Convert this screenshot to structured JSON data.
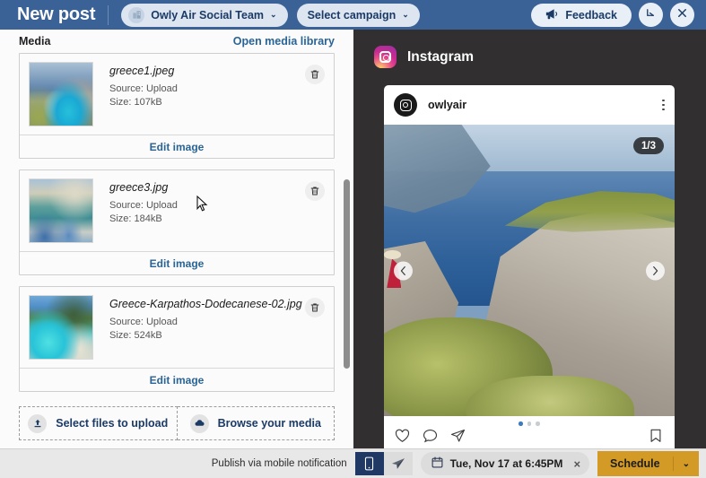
{
  "header": {
    "title": "New post",
    "team": {
      "label": "Owly Air Social Team",
      "icon": "building-icon",
      "caret": "⌄"
    },
    "campaign": {
      "label": "Select campaign",
      "caret": "⌄"
    },
    "feedback": {
      "label": "Feedback",
      "icon": "megaphone-icon"
    },
    "minimize_icon": "arrow-down-right-icon",
    "close_icon": "close-icon"
  },
  "composer": {
    "media_label": "Media",
    "open_library_label": "Open media library",
    "edit_label": "Edit image",
    "source_prefix": "Source:",
    "size_prefix": "Size:",
    "items": [
      {
        "filename": "greece1.jpeg",
        "source": "Source: Upload",
        "size": "Size: 107kB",
        "edit": "Edit image"
      },
      {
        "filename": "greece3.jpg",
        "source": "Source: Upload",
        "size": "Size: 184kB",
        "edit": "Edit image"
      },
      {
        "filename": "Greece-Karpathos-Dodecanese-02.jpg",
        "source": "Source: Upload",
        "size": "Size: 524kB",
        "edit": "Edit image"
      }
    ],
    "upload_buttons": [
      {
        "label": "Select files to upload",
        "icon": "upload-icon"
      },
      {
        "label": "Browse your media",
        "icon": "cloud-icon"
      }
    ]
  },
  "preview": {
    "network": "Instagram",
    "account": "owlyair",
    "counter": "1/3",
    "prev_icon": "chevron-left-icon",
    "next_icon": "chevron-right-icon",
    "menu_icon": "more-options-icon",
    "actions": [
      "like-icon",
      "comment-icon",
      "share-icon"
    ],
    "save_icon": "bookmark-icon",
    "carousel_dots": 3,
    "carousel_active": 1
  },
  "bottom": {
    "publish_note": "Publish via mobile notification",
    "mobile_icon": "mobile-phone-icon",
    "auto_icon": "paper-plane-icon",
    "date": "Tue, Nov 17 at 6:45PM",
    "date_icon": "calendar-icon",
    "clear_icon": "×",
    "schedule_label": "Schedule",
    "schedule_caret": "⌄"
  },
  "colors": {
    "header_bg": "#3a6297",
    "accent_link": "#2a6496",
    "preview_bg": "#312f2f",
    "schedule_bg": "#d39a26",
    "toggle_on": "#1f3864"
  }
}
